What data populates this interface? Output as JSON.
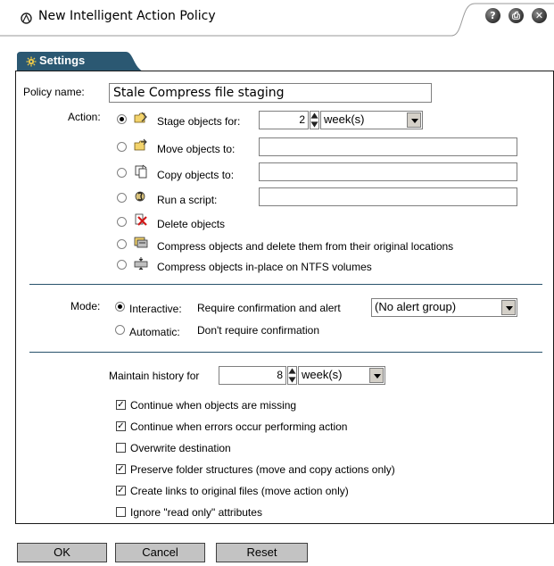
{
  "window": {
    "title": "New Intelligent Action Policy",
    "help_glyph": "?",
    "print_glyph": "⎙",
    "close_glyph": "✕"
  },
  "tabs": [
    {
      "label": "Settings",
      "icon": "gear-icon",
      "active": true
    }
  ],
  "policy": {
    "name_label": "Policy name:",
    "name_value": "Stale Compress file staging"
  },
  "action": {
    "label": "Action:",
    "options": [
      {
        "label": "Stage objects for:",
        "icon": "stage-folder-icon",
        "selected": true
      },
      {
        "label": "Move objects to:",
        "icon": "move-folder-icon",
        "selected": false
      },
      {
        "label": "Copy objects to:",
        "icon": "copy-document-icon",
        "selected": false
      },
      {
        "label": "Run a script:",
        "icon": "script-icon",
        "selected": false
      },
      {
        "label": "Delete objects",
        "icon": "delete-icon",
        "selected": false
      },
      {
        "label": "Compress objects and delete them from their original locations",
        "icon": "compress-move-icon",
        "selected": false
      },
      {
        "label": "Compress objects in-place on NTFS volumes",
        "icon": "compress-inplace-icon",
        "selected": false
      }
    ],
    "stage_amount": "2",
    "stage_unit": "week(s)",
    "move_to": "",
    "copy_to": "",
    "script": ""
  },
  "mode": {
    "label": "Mode:",
    "interactive_label": "Interactive:",
    "interactive_desc": "Require confirmation and alert",
    "interactive_selected": true,
    "alert_group": "(No alert group)",
    "automatic_label": "Automatic:",
    "automatic_desc": "Don't require confirmation",
    "automatic_selected": false
  },
  "history": {
    "label": "Maintain history for",
    "amount": "8",
    "unit": "week(s)"
  },
  "options": [
    {
      "label": "Continue when objects are missing",
      "checked": true
    },
    {
      "label": "Continue when errors occur performing action",
      "checked": true
    },
    {
      "label": "Overwrite destination",
      "checked": false
    },
    {
      "label": "Preserve folder structures (move and copy actions only)",
      "checked": true
    },
    {
      "label": "Create links to original files (move action only)",
      "checked": true
    },
    {
      "label": "Ignore \"read only\" attributes",
      "checked": false
    }
  ],
  "buttons": {
    "ok": "OK",
    "cancel": "Cancel",
    "reset": "Reset"
  },
  "colors": {
    "tab": "#2b5872",
    "separator": "#27526b",
    "button": "#c3c3c3"
  }
}
